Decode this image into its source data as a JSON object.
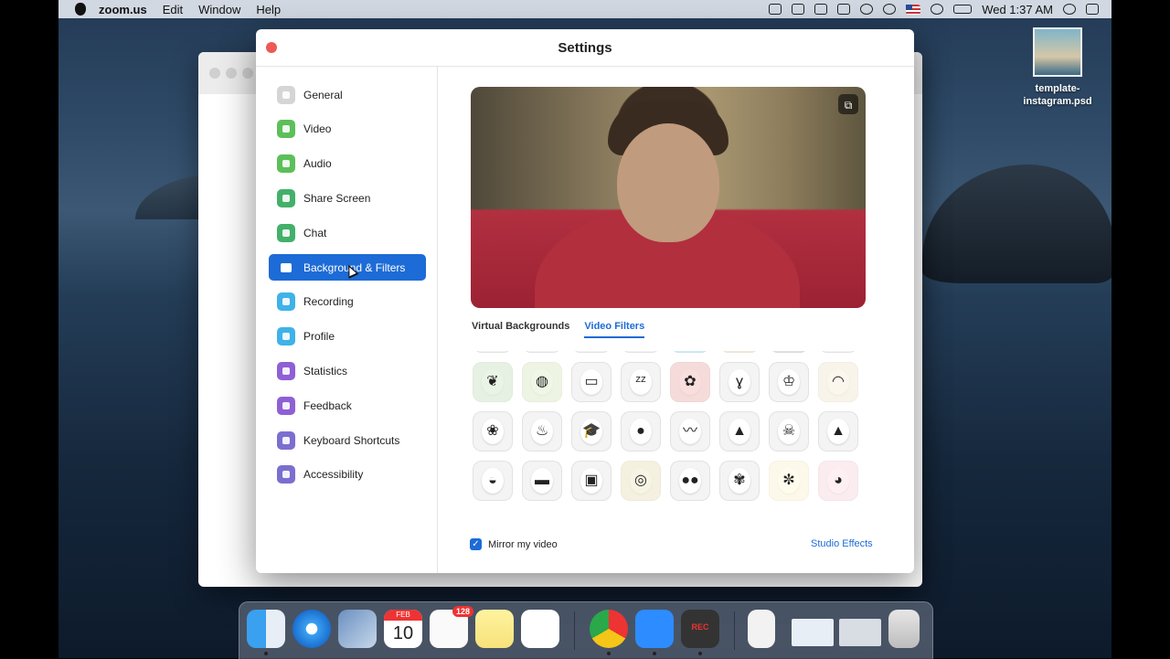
{
  "menubar": {
    "app_name": "zoom.us",
    "items": [
      "Edit",
      "Window",
      "Help"
    ],
    "clock": "Wed 1:37 AM"
  },
  "desktop": {
    "file_name": "template-\ninstagram.psd"
  },
  "settings": {
    "title": "Settings",
    "nav": [
      {
        "label": "General",
        "icon": "gear-icon",
        "color": "#d5d5d5"
      },
      {
        "label": "Video",
        "icon": "video-camera-icon",
        "color": "#5cbf59"
      },
      {
        "label": "Audio",
        "icon": "headphones-icon",
        "color": "#5cbf59"
      },
      {
        "label": "Share Screen",
        "icon": "share-screen-icon",
        "color": "#43b06a"
      },
      {
        "label": "Chat",
        "icon": "chat-icon",
        "color": "#43b06a"
      },
      {
        "label": "Background & Filters",
        "icon": "background-icon",
        "color": "#1d6bd6"
      },
      {
        "label": "Recording",
        "icon": "recording-icon",
        "color": "#3fb2e8"
      },
      {
        "label": "Profile",
        "icon": "profile-icon",
        "color": "#3fb2e8"
      },
      {
        "label": "Statistics",
        "icon": "statistics-icon",
        "color": "#8f5fd6"
      },
      {
        "label": "Feedback",
        "icon": "feedback-icon",
        "color": "#8f5fd6"
      },
      {
        "label": "Keyboard Shortcuts",
        "icon": "keyboard-icon",
        "color": "#7a6fd0"
      },
      {
        "label": "Accessibility",
        "icon": "accessibility-icon",
        "color": "#7a6fd0"
      }
    ],
    "active_nav": "Background & Filters",
    "tabs": {
      "virtual": "Virtual Backgrounds",
      "filters": "Video Filters"
    },
    "active_tab": "Video Filters",
    "mirror_label": "Mirror my video",
    "mirror_checked": true,
    "studio_effects": "Studio Effects"
  },
  "filters": [
    {
      "name": "pig-nose-filter",
      "glyph": "",
      "tint": ""
    },
    {
      "name": "face-filter",
      "glyph": "",
      "tint": ""
    },
    {
      "name": "bunny-filter",
      "glyph": "",
      "tint": ""
    },
    {
      "name": "face-filter-2",
      "glyph": "",
      "tint": ""
    },
    {
      "name": "mask-filter",
      "glyph": "",
      "tint": "#bfe6f5"
    },
    {
      "name": "frame-filter",
      "glyph": "",
      "tint": "#efe6cf"
    },
    {
      "name": "tv-filter",
      "glyph": "",
      "tint": "#d8d8d8"
    },
    {
      "name": "headphones-filter",
      "glyph": "",
      "tint": ""
    },
    {
      "name": "leaves-frame-filter",
      "glyph": "❦",
      "tint": "#dff0dc"
    },
    {
      "name": "lollipop-filter",
      "glyph": "◍",
      "tint": "#e9f4dc"
    },
    {
      "name": "loading-bar-filter",
      "glyph": "▭",
      "tint": ""
    },
    {
      "name": "sleepy-filter",
      "glyph": "ᶻᶻ",
      "tint": ""
    },
    {
      "name": "polka-bandana-filter",
      "glyph": "✿",
      "tint": "#f6d0d0"
    },
    {
      "name": "antenna-filter",
      "glyph": "ɣ",
      "tint": ""
    },
    {
      "name": "crown-filter",
      "glyph": "♔",
      "tint": ""
    },
    {
      "name": "veil-filter",
      "glyph": "◠",
      "tint": "#faf4e6"
    },
    {
      "name": "flower-hat-filter",
      "glyph": "❀",
      "tint": ""
    },
    {
      "name": "chef-hat-filter",
      "glyph": "♨",
      "tint": ""
    },
    {
      "name": "graduation-cap-filter",
      "glyph": "🎓",
      "tint": ""
    },
    {
      "name": "red-beret-filter",
      "glyph": "●",
      "tint": ""
    },
    {
      "name": "mustache-filter",
      "glyph": "〰",
      "tint": ""
    },
    {
      "name": "bandit-hat-filter",
      "glyph": "▲",
      "tint": ""
    },
    {
      "name": "pirate-filter",
      "glyph": "☠",
      "tint": ""
    },
    {
      "name": "black-hat-filter",
      "glyph": "▲",
      "tint": ""
    },
    {
      "name": "beret-filter",
      "glyph": "◒",
      "tint": ""
    },
    {
      "name": "3d-glasses-filter",
      "glyph": "▬",
      "tint": ""
    },
    {
      "name": "vr-headset-filter",
      "glyph": "▣",
      "tint": ""
    },
    {
      "name": "ski-goggles-filter",
      "glyph": "◎",
      "tint": "#f3f0d8"
    },
    {
      "name": "round-sunglasses-filter",
      "glyph": "●●",
      "tint": ""
    },
    {
      "name": "flower-crown-filter",
      "glyph": "✾",
      "tint": ""
    },
    {
      "name": "daisy-filter",
      "glyph": "✼",
      "tint": "#fffbe6"
    },
    {
      "name": "blush-filter",
      "glyph": "◕",
      "tint": "#fde8ee"
    }
  ],
  "dock": {
    "calendar_month": "FEB",
    "calendar_day": "10",
    "reminders_badge": "128",
    "rec_label": "REC"
  }
}
